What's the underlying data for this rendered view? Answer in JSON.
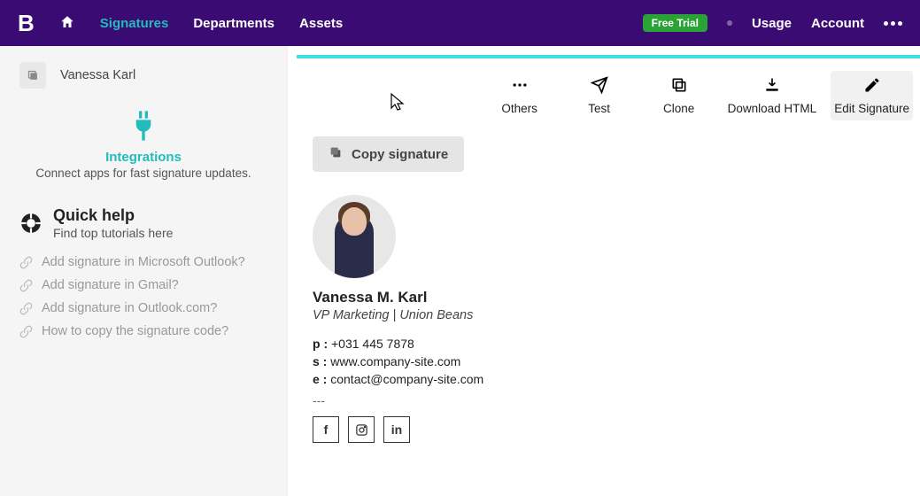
{
  "navbar": {
    "logo": "B",
    "items": [
      "Signatures",
      "Departments",
      "Assets"
    ],
    "active_index": 0,
    "badge": "Free Trial",
    "right_items": [
      "Usage",
      "Account"
    ]
  },
  "sidebar": {
    "user_name": "Vanessa Karl",
    "integrations": {
      "title": "Integrations",
      "subtitle": "Connect apps for fast signature updates."
    },
    "help": {
      "title": "Quick help",
      "subtitle": "Find top tutorials here",
      "links": [
        "Add signature in Microsoft Outlook?",
        "Add signature in Gmail?",
        "Add signature in Outlook.com?",
        "How to copy the signature code?"
      ]
    }
  },
  "toolbar": {
    "items": [
      {
        "label": "Others",
        "icon": "dots"
      },
      {
        "label": "Test",
        "icon": "send"
      },
      {
        "label": "Clone",
        "icon": "clone"
      },
      {
        "label": "Download HTML",
        "icon": "download"
      },
      {
        "label": "Edit Signature",
        "icon": "edit",
        "active": true
      }
    ],
    "copy_label": "Copy signature"
  },
  "signature": {
    "name": "Vanessa M. Karl",
    "title": "VP Marketing | Union Beans",
    "phone_label": "p :",
    "phone": "+031 445 7878",
    "site_label": "s :",
    "site": "www.company-site.com",
    "email_label": "e :",
    "email": "contact@company-site.com",
    "divider": "---",
    "socials": [
      "f",
      "ig",
      "in"
    ]
  }
}
